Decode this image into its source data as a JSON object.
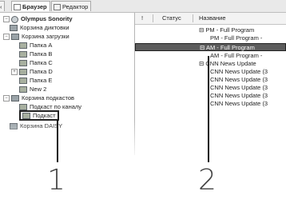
{
  "tabs": [
    {
      "label": "Браузер",
      "icon": "browser-icon"
    },
    {
      "label": "Редактор",
      "icon": "editor-icon"
    }
  ],
  "tree": {
    "root": "Olympus Sonority",
    "items": [
      "Корзина диктовки",
      "Корзина загрузки",
      "Папка A",
      "Папка B",
      "Папка C",
      "Папка D",
      "Папка E",
      "New 2",
      "Корзина подкастов",
      "Подкаст по каналу",
      "Подкаст",
      "Корзина DAISY"
    ]
  },
  "list": {
    "headers": [
      "!",
      "Статус",
      "Название"
    ],
    "rows": [
      "PM - Full Program",
      "PM - Full Program -",
      "AM - Full Program",
      "AM - Full Program -",
      "CNN News Update",
      "CNN News Update (3",
      "CNN News Update (3",
      "CNN News Update (3",
      "CNN News Update (3",
      "CNN News Update (3"
    ]
  },
  "callouts": [
    "1",
    "2"
  ]
}
